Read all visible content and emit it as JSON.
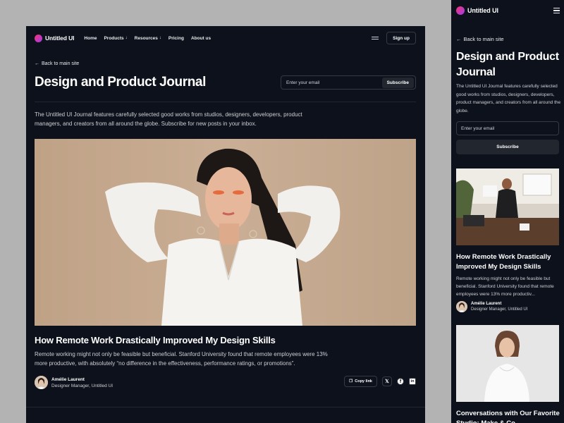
{
  "colors": {
    "page_bg": "#0d111c",
    "outer_bg": "#b3b3b3",
    "border": "#373a41",
    "muted_text": "#cecfd2",
    "logo_gradient": [
      "#f7346f",
      "#a03cf0"
    ]
  },
  "desktop": {
    "logo_text": "Untitled UI",
    "nav_items": [
      "Home",
      "Products",
      "Resources",
      "Pricing",
      "About us"
    ],
    "signup_label": "Sign up",
    "back_label": "Back to main site",
    "title": "Design and Product Journal",
    "email_placeholder": "Enter your email",
    "subscribe_label": "Subscribe",
    "intro": "The Untitled UI Journal features carefully selected good works from studios, designers, developers, product managers, and creators from all around the globe. Subscribe for new posts in your inbox.",
    "featured": {
      "title": "How Remote Work Drastically Improved My Design Skills",
      "excerpt": "Remote working might not only be feasible but beneficial. Stanford University found that remote employees were 13% more productive, with absolutely “no difference in the effectiveness, performance ratings, or promotions”.",
      "author_name": "Amélie Laurent",
      "author_role": "Designer Manager, Untitled UI",
      "copy_link_label": "Copy link"
    },
    "share_icons": [
      "x-icon",
      "facebook-icon",
      "linkedin-icon"
    ]
  },
  "mobile": {
    "logo_text": "Untitled UI",
    "back_label": "Back to main site",
    "title": "Design and Product Journal",
    "intro": "The Untitled UI Journal features carefully selected good works from studios, designers, developers, product managers, and creators from all around the globe.",
    "email_placeholder": "Enter your email",
    "subscribe_label": "Subscribe",
    "posts": [
      {
        "title": "How Remote Work Drastically Improved My Design Skills",
        "excerpt": "Remote working might not only be feasible but beneficial. Stanford University found that remote employees were 13% more productiv...",
        "author_name": "Amélie Laurent",
        "author_role": "Designer Manager, Untitled UI"
      },
      {
        "title": "Conversations with Our Favorite Studio: Make & Co"
      }
    ]
  }
}
